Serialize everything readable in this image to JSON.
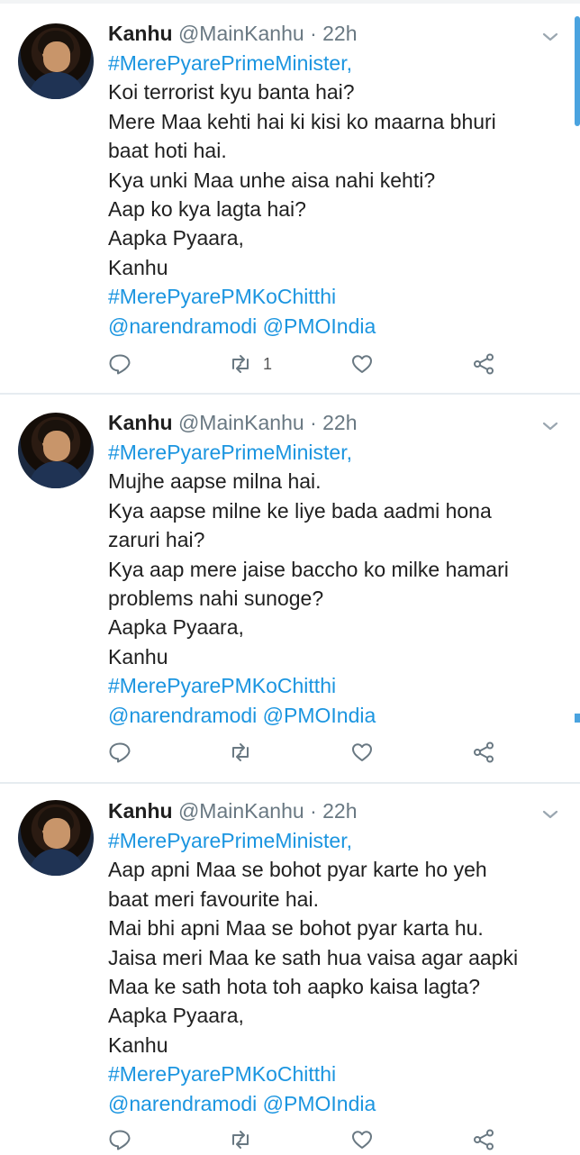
{
  "tweets": [
    {
      "name": "Kanhu",
      "handle": "@MainKanhu",
      "dot": "·",
      "time": "22h",
      "lines": [
        {
          "text": "#MerePyarePrimeMinister,",
          "link": true
        },
        {
          "text": "Koi terrorist kyu banta hai?",
          "link": false
        },
        {
          "text": "Mere Maa kehti hai ki kisi ko maarna bhuri",
          "link": false
        },
        {
          "text": "baat hoti hai.",
          "link": false
        },
        {
          "text": "Kya unki Maa unhe aisa nahi kehti?",
          "link": false
        },
        {
          "text": "Aap ko kya lagta hai?",
          "link": false
        },
        {
          "text": "Aapka Pyaara,",
          "link": false
        },
        {
          "text": "Kanhu",
          "link": false
        },
        {
          "text": "#MerePyarePMKoChitthi",
          "link": true
        },
        {
          "text": "@narendramodi @PMOIndia",
          "link": true
        }
      ],
      "retweet_count": "1"
    },
    {
      "name": "Kanhu",
      "handle": "@MainKanhu",
      "dot": "·",
      "time": "22h",
      "lines": [
        {
          "text": "#MerePyarePrimeMinister,",
          "link": true
        },
        {
          "text": "Mujhe aapse milna hai.",
          "link": false
        },
        {
          "text": "Kya aapse milne ke liye bada aadmi hona",
          "link": false
        },
        {
          "text": "zaruri hai?",
          "link": false
        },
        {
          "text": "Kya aap mere jaise baccho ko milke hamari",
          "link": false
        },
        {
          "text": "problems nahi sunoge?",
          "link": false
        },
        {
          "text": "Aapka Pyaara,",
          "link": false
        },
        {
          "text": "Kanhu",
          "link": false
        },
        {
          "text": "#MerePyarePMKoChitthi",
          "link": true
        },
        {
          "text": "@narendramodi @PMOIndia",
          "link": true
        }
      ],
      "retweet_count": ""
    },
    {
      "name": "Kanhu",
      "handle": "@MainKanhu",
      "dot": "·",
      "time": "22h",
      "lines": [
        {
          "text": "#MerePyarePrimeMinister,",
          "link": true
        },
        {
          "text": "Aap apni Maa se bohot pyar karte ho yeh",
          "link": false
        },
        {
          "text": "baat meri favourite hai.",
          "link": false
        },
        {
          "text": "Mai bhi apni Maa se bohot pyar karta hu.",
          "link": false
        },
        {
          "text": "Jaisa meri Maa ke sath hua vaisa agar aapki",
          "link": false
        },
        {
          "text": "Maa ke sath hota toh aapko kaisa lagta?",
          "link": false
        },
        {
          "text": "Aapka Pyaara,",
          "link": false
        },
        {
          "text": "Kanhu",
          "link": false
        },
        {
          "text": "#MerePyarePMKoChitthi",
          "link": true
        },
        {
          "text": "@narendramodi @PMOIndia",
          "link": true
        }
      ],
      "retweet_count": ""
    }
  ],
  "colors": {
    "link": "#1b95e0",
    "icon": "#697882",
    "divider": "#e6ecf0",
    "scrollbar": "#4aa3df"
  },
  "icons": {
    "reply": "reply-icon",
    "retweet": "retweet-icon",
    "like": "heart-icon",
    "share": "share-icon",
    "menu": "chevron-down-icon"
  }
}
